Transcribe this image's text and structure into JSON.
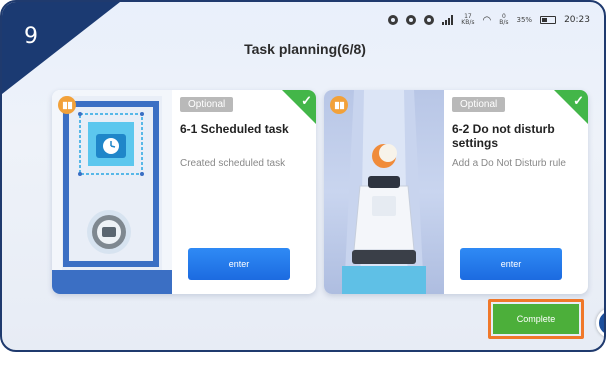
{
  "step": {
    "number": "9"
  },
  "status_bar": {
    "network_kbs": "17",
    "network_kbs_unit": "KB/s",
    "wifi_bs": "0",
    "wifi_bs_unit": "B/s",
    "battery": "35%",
    "time": "20:23"
  },
  "page": {
    "title": "Task planning(6/8)"
  },
  "cards": [
    {
      "badge": "Optional",
      "title": "6-1 Scheduled task",
      "description": "Created scheduled task",
      "button": "enter",
      "completed": true
    },
    {
      "badge": "Optional",
      "title": "6-2 Do not disturb settings",
      "description": "Add a Do Not Disturb rule",
      "button": "enter",
      "completed": true
    }
  ],
  "footer": {
    "complete_label": "Complete"
  },
  "colors": {
    "accent_blue": "#1c6be0",
    "complete_green": "#4caf3a",
    "highlight_orange": "#f0782a",
    "check_green": "#43b649",
    "step_navy": "#1b3a72"
  },
  "icons": [
    "book-icon",
    "check-icon",
    "clock-icon",
    "moon-icon",
    "robot-icon",
    "wifi-icon",
    "signal-icon",
    "battery-icon"
  ]
}
